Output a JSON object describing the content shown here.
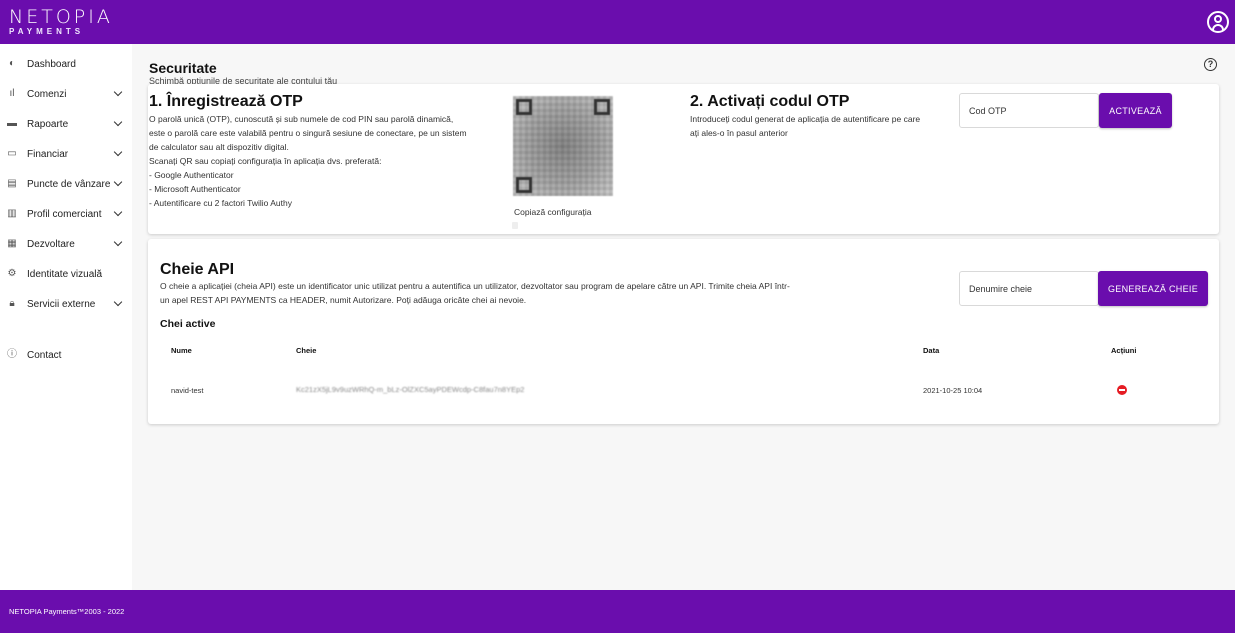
{
  "header": {
    "logo_top": "NETOPIA",
    "logo_bottom": "PAYMENTS"
  },
  "sidebar": {
    "items": [
      {
        "label": "Dashboard",
        "icon": "pie-chart-icon",
        "has_chevron": false
      },
      {
        "label": "Comenzi",
        "icon": "bar-chart-icon",
        "has_chevron": true
      },
      {
        "label": "Rapoarte",
        "icon": "message-icon",
        "has_chevron": true
      },
      {
        "label": "Financiar",
        "icon": "money-icon",
        "has_chevron": true
      },
      {
        "label": "Puncte de vânzare",
        "icon": "store-icon",
        "has_chevron": true
      },
      {
        "label": "Profil comerciant",
        "icon": "building-icon",
        "has_chevron": true
      },
      {
        "label": "Dezvoltare",
        "icon": "grid-icon",
        "has_chevron": true
      },
      {
        "label": "Identitate vizuală",
        "icon": "gear-icon",
        "has_chevron": false
      },
      {
        "label": "Servicii externe",
        "icon": "lock-icon",
        "has_chevron": true
      },
      {
        "label": "Contact",
        "icon": "help-circle-icon",
        "has_chevron": false
      }
    ]
  },
  "page": {
    "title": "Securitate",
    "subtitle": "Schimbă opțiunile de securitate ale contului tău"
  },
  "otp": {
    "step1_title": "1. Înregistrează OTP",
    "step1_lines": [
      "O parolă unică (OTP), cunoscută și sub numele de cod PIN sau parolă dinamică,",
      "este o parolă care este valabilă pentru o singură sesiune de conectare, pe un sistem",
      "de calculator sau alt dispozitiv digital.",
      "Scanați QR sau copiați configurația în aplicația dvs. preferată:",
      "- Google Authenticator",
      "- Microsoft Authenticator",
      "- Autentificare cu 2 factori Twilio Authy"
    ],
    "copy_config": "Copiază configurația",
    "step2_title": "2. Activați codul OTP",
    "step2_lines": [
      "Introduceți codul generat de aplicația de autentificare pe care",
      "ați ales-o în pasul anterior"
    ],
    "code_placeholder": "Cod OTP",
    "activate_label": "ACTIVEAZĂ"
  },
  "api": {
    "title": "Cheie API",
    "desc_lines": [
      "O cheie a aplicației (cheia API) este un identificator unic utilizat pentru a autentifica un utilizator, dezvoltator sau program de apelare către un API. Trimite cheia API într-",
      "un apel REST API PAYMENTS ca HEADER, numit Autorizare. Poți adăuga oricâte chei ai nevoie."
    ],
    "name_placeholder": "Denumire cheie",
    "generate_label": "GENEREAZĂ CHEIE",
    "active_title": "Chei active",
    "columns": {
      "name": "Nume",
      "key": "Cheie",
      "date": "Data",
      "actions": "Acțiuni"
    },
    "rows": [
      {
        "name": "navid-test",
        "key": "Kc21zX5jL9v9uzWRhQ-m_bLz-OlZXC5ayPDEWcdp-C8fau7n8YEp2",
        "date": "2021-10-25 10:04"
      }
    ]
  },
  "footer": {
    "text": "NETOPIA Payments™2003 - 2022"
  },
  "colors": {
    "brand": "#6a0dad",
    "danger": "#e51c23"
  }
}
